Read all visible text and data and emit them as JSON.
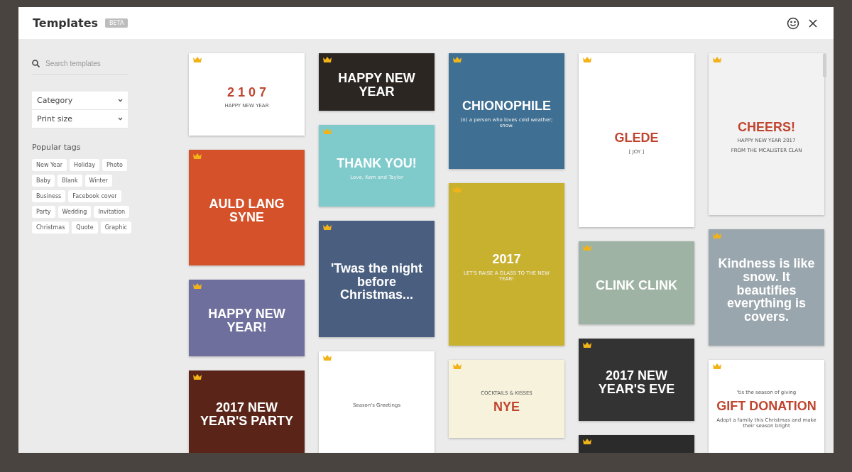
{
  "dialog": {
    "title": "Templates",
    "badge": "BETA"
  },
  "sidebar": {
    "search": {
      "placeholder": "Search templates"
    },
    "selects": [
      {
        "label": "Category"
      },
      {
        "label": "Print size"
      }
    ],
    "tags_heading": "Popular tags",
    "tags": [
      "New Year",
      "Holiday",
      "Photo",
      "Baby",
      "Blank",
      "Winter",
      "Business",
      "Facebook cover",
      "Party",
      "Wedding",
      "Invitation",
      "Christmas",
      "Quote",
      "Graphic"
    ]
  },
  "templates": [
    [
      {
        "kind": "light",
        "color": "#ffffff",
        "headline": "2 1 0 7",
        "lines": [
          "HAPPY NEW YEAR"
        ]
      },
      {
        "kind": "dark",
        "color": "#d4512a",
        "headline": "AULD LANG SYNE"
      },
      {
        "kind": "dark",
        "color": "#6f6f9e",
        "headline": "HAPPY NEW YEAR!"
      },
      {
        "kind": "dark",
        "color": "#5a2418",
        "headline": "2017 NEW YEAR'S PARTY"
      }
    ],
    [
      {
        "kind": "dark",
        "color": "#2b2622",
        "headline": "HAPPY NEW YEAR"
      },
      {
        "kind": "dark",
        "color": "#7fcbcc",
        "headline": "THANK YOU!",
        "lines": [
          "Love, Kem and Taylor"
        ]
      },
      {
        "kind": "dark",
        "color": "#4a5f80",
        "headline": "'Twas the night before Christmas..."
      },
      {
        "kind": "light",
        "color": "#ffffff",
        "lines": [
          "Season's Greetings"
        ]
      }
    ],
    [
      {
        "kind": "dark",
        "color": "#3f6f92",
        "headline": "CHIONOPHILE",
        "lines": [
          "(n) a person who loves cold weather; snow."
        ]
      },
      {
        "kind": "dark",
        "color": "#c9b130",
        "headline": "2017",
        "lines": [
          "LET'S RAISE A GLASS TO THE NEW YEAR!"
        ]
      },
      {
        "kind": "light",
        "color": "#f6f2dc",
        "tagline": "COCKTAILS & KISSES",
        "headline": "NYE"
      }
    ],
    [
      {
        "kind": "light",
        "color": "#ffffff",
        "headline": "GLEDE",
        "lines": [
          "[ JOY ]"
        ]
      },
      {
        "kind": "dark",
        "color": "#9fb3a4",
        "headline": "CLINK CLINK"
      },
      {
        "kind": "dark",
        "color": "#333333",
        "headline": "2017 NEW YEAR'S EVE"
      },
      {
        "kind": "dark",
        "color": "#2b2b2b"
      }
    ],
    [
      {
        "kind": "light",
        "color": "#f2f2f2",
        "headline": "CHEERS!",
        "lines": [
          "HAPPY NEW YEAR 2017",
          "FROM THE MCALISTER CLAN"
        ]
      },
      {
        "kind": "dark",
        "color": "#9aa6ad",
        "headline": "Kindness is like snow. It beautifies everything is covers."
      },
      {
        "kind": "light",
        "color": "#ffffff",
        "tagline": "'tis the season of giving",
        "headline": "GIFT DONATION",
        "lines": [
          "Adopt a family this Christmas and make their season bright"
        ]
      }
    ]
  ]
}
